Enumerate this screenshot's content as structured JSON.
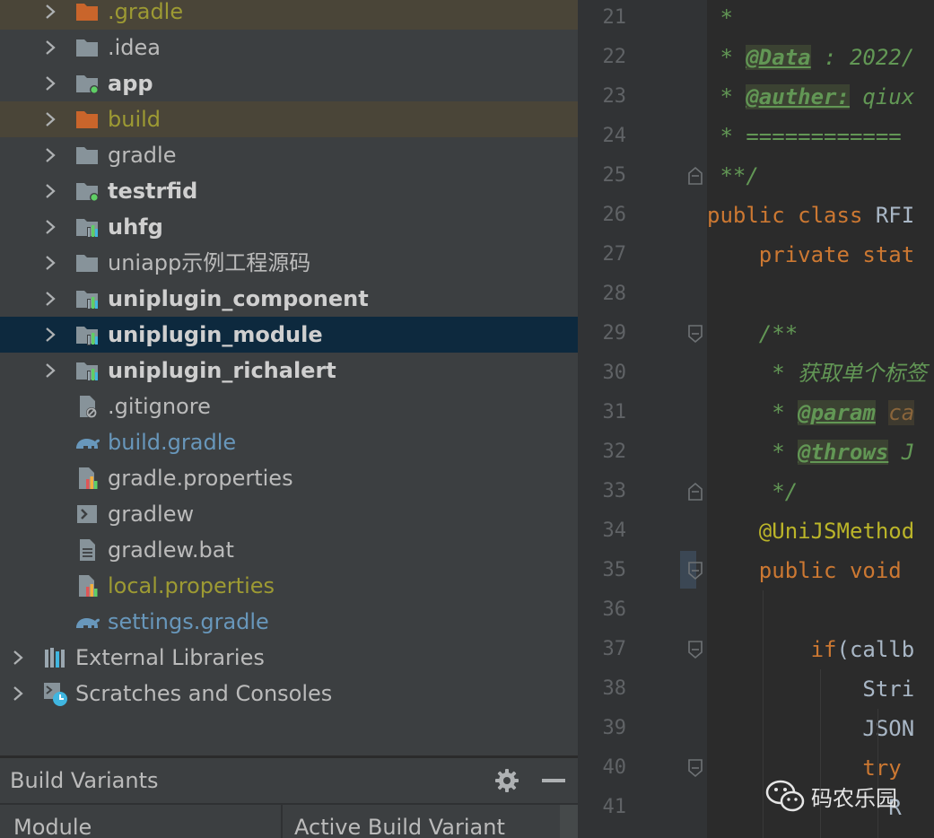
{
  "project_tree": {
    "items": [
      {
        "label": ".gradle",
        "icon": "folder-orange-icon",
        "style": "olive",
        "bold": false,
        "highlight": "ignored",
        "level": 1,
        "chevron": true
      },
      {
        "label": ".idea",
        "icon": "folder-icon",
        "style": "normal",
        "bold": false,
        "highlight": "",
        "level": 1,
        "chevron": true
      },
      {
        "label": "app",
        "icon": "module-folder-icon",
        "style": "normal",
        "bold": true,
        "highlight": "",
        "level": 1,
        "chevron": true
      },
      {
        "label": "build",
        "icon": "folder-orange-icon",
        "style": "olive",
        "bold": false,
        "highlight": "ignored",
        "level": 1,
        "chevron": true
      },
      {
        "label": "gradle",
        "icon": "folder-icon",
        "style": "normal",
        "bold": false,
        "highlight": "",
        "level": 1,
        "chevron": true
      },
      {
        "label": "testrfid",
        "icon": "module-folder-icon",
        "style": "normal",
        "bold": true,
        "highlight": "",
        "level": 1,
        "chevron": true
      },
      {
        "label": "uhfg",
        "icon": "library-module-icon",
        "style": "normal",
        "bold": true,
        "highlight": "",
        "level": 1,
        "chevron": true
      },
      {
        "label": "uniapp示例工程源码",
        "icon": "folder-icon",
        "style": "normal",
        "bold": false,
        "highlight": "",
        "level": 1,
        "chevron": true
      },
      {
        "label": "uniplugin_component",
        "icon": "library-module-icon",
        "style": "normal",
        "bold": true,
        "highlight": "",
        "level": 1,
        "chevron": true
      },
      {
        "label": "uniplugin_module",
        "icon": "library-module-icon",
        "style": "normal",
        "bold": true,
        "highlight": "selected",
        "level": 1,
        "chevron": true
      },
      {
        "label": "uniplugin_richalert",
        "icon": "library-module-icon",
        "style": "normal",
        "bold": true,
        "highlight": "",
        "level": 1,
        "chevron": true
      },
      {
        "label": ".gitignore",
        "icon": "ignore-file-icon",
        "style": "normal",
        "bold": false,
        "highlight": "",
        "level": 1,
        "chevron": false
      },
      {
        "label": "build.gradle",
        "icon": "gradle-elephant-icon",
        "style": "blue",
        "bold": false,
        "highlight": "",
        "level": 1,
        "chevron": false
      },
      {
        "label": "gradle.properties",
        "icon": "properties-file-icon",
        "style": "normal",
        "bold": false,
        "highlight": "",
        "level": 1,
        "chevron": false
      },
      {
        "label": "gradlew",
        "icon": "shell-script-icon",
        "style": "normal",
        "bold": false,
        "highlight": "",
        "level": 1,
        "chevron": false
      },
      {
        "label": "gradlew.bat",
        "icon": "text-file-icon",
        "style": "normal",
        "bold": false,
        "highlight": "",
        "level": 1,
        "chevron": false
      },
      {
        "label": "local.properties",
        "icon": "properties-file-icon",
        "style": "olive",
        "bold": false,
        "highlight": "",
        "level": 1,
        "chevron": false
      },
      {
        "label": "settings.gradle",
        "icon": "gradle-elephant-icon",
        "style": "blue",
        "bold": false,
        "highlight": "",
        "level": 1,
        "chevron": false
      },
      {
        "label": "External Libraries",
        "icon": "external-libraries-icon",
        "style": "normal",
        "bold": false,
        "highlight": "",
        "level": 0,
        "chevron": true
      },
      {
        "label": "Scratches and Consoles",
        "icon": "scratches-icon",
        "style": "normal",
        "bold": false,
        "highlight": "",
        "level": 0,
        "chevron": true
      }
    ]
  },
  "build_variants": {
    "title": "Build Variants",
    "columns": [
      "Module",
      "Active Build Variant"
    ]
  },
  "editor": {
    "lines": [
      {
        "n": "21",
        "html": "<span class=\"cm\"> *</span>"
      },
      {
        "n": "22",
        "html": "<span class=\"cm\"> * </span><span class=\"tag\">@Data</span><span class=\"cm\"> : 2022/</span>"
      },
      {
        "n": "23",
        "html": "<span class=\"cm\"> * </span><span class=\"tag\">@auther:</span><span class=\"cm\"> qiux</span>"
      },
      {
        "n": "24",
        "html": "<span class=\"cm\"> * ============</span>"
      },
      {
        "n": "25",
        "html": "<span class=\"cm\"> **/</span>"
      },
      {
        "n": "26",
        "html": "<span class=\"kw\">public class </span>RFI"
      },
      {
        "n": "27",
        "html": "    <span class=\"kw\">private stat</span>"
      },
      {
        "n": "28",
        "html": ""
      },
      {
        "n": "29",
        "html": "    <span class=\"cm\">/**</span>"
      },
      {
        "n": "30",
        "html": "<span class=\"cm\">     * 获取单个标签</span>"
      },
      {
        "n": "31",
        "html": "<span class=\"cm\">     * </span><span class=\"tag\">@param</span><span class=\"cm\"> </span><span class=\"par\">ca</span>"
      },
      {
        "n": "32",
        "html": "<span class=\"cm\">     * </span><span class=\"tag\">@throws</span><span class=\"cm\"> J</span>"
      },
      {
        "n": "33",
        "html": "<span class=\"cm\">     */</span>"
      },
      {
        "n": "34",
        "html": "    <span class=\"ann\">@UniJSMethod</span>"
      },
      {
        "n": "35",
        "html": "    <span class=\"kw\">public void </span>"
      },
      {
        "n": "36",
        "html": ""
      },
      {
        "n": "37",
        "html": "        <span class=\"kw\">if</span>(callb"
      },
      {
        "n": "38",
        "html": "            Stri"
      },
      {
        "n": "39",
        "html": "            JSON"
      },
      {
        "n": "40",
        "html": "            <span class=\"kw\">try</span>"
      },
      {
        "n": "41",
        "html": "              R"
      }
    ],
    "folds": [
      {
        "line": "25",
        "type": "end"
      },
      {
        "line": "29",
        "type": "start"
      },
      {
        "line": "33",
        "type": "end"
      },
      {
        "line": "35",
        "type": "start"
      },
      {
        "line": "37",
        "type": "start"
      },
      {
        "line": "40",
        "type": "start"
      }
    ]
  },
  "watermark": {
    "text": "码农乐园",
    "icon": "wechat-icon"
  },
  "colors": {
    "panel_bg": "#3c3f41",
    "editor_bg": "#2b2b2b",
    "selected_row": "#0d293e",
    "ignored_row": "#4a4538"
  }
}
